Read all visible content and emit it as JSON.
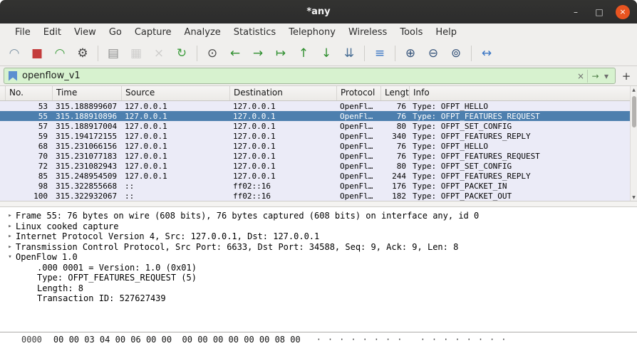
{
  "window": {
    "title": "*any",
    "controls": {
      "minimize": "–",
      "maximize": "□",
      "close": "×"
    }
  },
  "colors": {
    "titlebar_bg": "#2c2c2c",
    "close_button_bg": "#e95420",
    "filter_valid_bg": "#d7f2cf",
    "row_bg": "#ebebf7",
    "selected_row_bg": "#4d7fae",
    "selected_row_fg": "#ffffff"
  },
  "menu": {
    "items": [
      "File",
      "Edit",
      "View",
      "Go",
      "Capture",
      "Analyze",
      "Statistics",
      "Telephony",
      "Wireless",
      "Tools",
      "Help"
    ]
  },
  "toolbar": {
    "buttons": [
      {
        "name": "start-capture-icon",
        "glyph": "◠",
        "color": "#7d93a5"
      },
      {
        "name": "stop-capture-icon",
        "glyph": "■",
        "color": "#c43c3c"
      },
      {
        "name": "restart-capture-icon",
        "glyph": "◠",
        "color": "#3f9e3f"
      },
      {
        "name": "capture-options-icon",
        "glyph": "⚙",
        "color": "#474747"
      },
      {
        "sep": true
      },
      {
        "name": "open-file-icon",
        "glyph": "▤",
        "color": "#8c8c8c"
      },
      {
        "name": "save-file-icon",
        "glyph": "▦",
        "color": "#9a9a9a",
        "disabled": true
      },
      {
        "name": "close-file-icon",
        "glyph": "×",
        "color": "#9a9a9a",
        "disabled": true
      },
      {
        "name": "reload-file-icon",
        "glyph": "↻",
        "color": "#3f9e3f"
      },
      {
        "sep": true
      },
      {
        "name": "find-packet-icon",
        "glyph": "⊙",
        "color": "#474747"
      },
      {
        "name": "go-back-icon",
        "glyph": "←",
        "color": "#2f8f2f"
      },
      {
        "name": "go-forward-icon",
        "glyph": "→",
        "color": "#2f8f2f"
      },
      {
        "name": "go-to-packet-icon",
        "glyph": "↦",
        "color": "#2f8f2f"
      },
      {
        "name": "go-first-icon",
        "glyph": "↑",
        "color": "#2f8f2f"
      },
      {
        "name": "go-last-icon",
        "glyph": "↓",
        "color": "#2f8f2f"
      },
      {
        "name": "auto-scroll-icon",
        "glyph": "⇊",
        "color": "#4a6f95"
      },
      {
        "sep": true
      },
      {
        "name": "colorize-icon",
        "glyph": "≡",
        "color": "#3a76c4"
      },
      {
        "sep": true
      },
      {
        "name": "zoom-in-icon",
        "glyph": "⊕",
        "color": "#35537a"
      },
      {
        "name": "zoom-out-icon",
        "glyph": "⊖",
        "color": "#35537a"
      },
      {
        "name": "zoom-reset-icon",
        "glyph": "⊚",
        "color": "#35537a"
      },
      {
        "sep": true
      },
      {
        "name": "resize-columns-icon",
        "glyph": "↔",
        "color": "#3a76c4"
      }
    ]
  },
  "filter": {
    "value": "openflow_v1",
    "clear_glyph": "×",
    "apply_glyph": "→",
    "dropdown_glyph": "▾",
    "add_label": "+"
  },
  "packet_list": {
    "columns": [
      "No.",
      "Time",
      "Source",
      "Destination",
      "Protocol",
      "Length",
      "Info"
    ],
    "rows": [
      {
        "no": "53",
        "time": "315.188899607",
        "source": "127.0.0.1",
        "destination": "127.0.0.1",
        "protocol": "OpenFl…",
        "length": "76",
        "info": "Type: OFPT_HELLO",
        "selected": false
      },
      {
        "no": "55",
        "time": "315.188910896",
        "source": "127.0.0.1",
        "destination": "127.0.0.1",
        "protocol": "OpenFl…",
        "length": "76",
        "info": "Type: OFPT_FEATURES_REQUEST",
        "selected": true
      },
      {
        "no": "57",
        "time": "315.188917004",
        "source": "127.0.0.1",
        "destination": "127.0.0.1",
        "protocol": "OpenFl…",
        "length": "80",
        "info": "Type: OFPT_SET_CONFIG",
        "selected": false
      },
      {
        "no": "59",
        "time": "315.194172155",
        "source": "127.0.0.1",
        "destination": "127.0.0.1",
        "protocol": "OpenFl…",
        "length": "340",
        "info": "Type: OFPT_FEATURES_REPLY",
        "selected": false
      },
      {
        "no": "68",
        "time": "315.231066156",
        "source": "127.0.0.1",
        "destination": "127.0.0.1",
        "protocol": "OpenFl…",
        "length": "76",
        "info": "Type: OFPT_HELLO",
        "selected": false
      },
      {
        "no": "70",
        "time": "315.231077183",
        "source": "127.0.0.1",
        "destination": "127.0.0.1",
        "protocol": "OpenFl…",
        "length": "76",
        "info": "Type: OFPT_FEATURES_REQUEST",
        "selected": false
      },
      {
        "no": "72",
        "time": "315.231082943",
        "source": "127.0.0.1",
        "destination": "127.0.0.1",
        "protocol": "OpenFl…",
        "length": "80",
        "info": "Type: OFPT_SET_CONFIG",
        "selected": false
      },
      {
        "no": "85",
        "time": "315.248954509",
        "source": "127.0.0.1",
        "destination": "127.0.0.1",
        "protocol": "OpenFl…",
        "length": "244",
        "info": "Type: OFPT_FEATURES_REPLY",
        "selected": false
      },
      {
        "no": "98",
        "time": "315.322855668",
        "source": "::",
        "destination": "ff02::16",
        "protocol": "OpenFl…",
        "length": "176",
        "info": "Type: OFPT_PACKET_IN",
        "selected": false
      },
      {
        "no": "100",
        "time": "315.322932067",
        "source": "::",
        "destination": "ff02::16",
        "protocol": "OpenFl…",
        "length": "182",
        "info": "Type: OFPT_PACKET_OUT",
        "selected": false
      }
    ]
  },
  "scrollbar": {
    "up": "▲",
    "down": "▼"
  },
  "detail": {
    "collapsed_glyph": "▸",
    "expanded_glyph": "▾",
    "lines": [
      {
        "expanded": false,
        "child": false,
        "text": "Frame 55: 76 bytes on wire (608 bits), 76 bytes captured (608 bits) on interface any, id 0"
      },
      {
        "expanded": false,
        "child": false,
        "text": "Linux cooked capture"
      },
      {
        "expanded": false,
        "child": false,
        "text": "Internet Protocol Version 4, Src: 127.0.0.1, Dst: 127.0.0.1"
      },
      {
        "expanded": false,
        "child": false,
        "text": "Transmission Control Protocol, Src Port: 6633, Dst Port: 34588, Seq: 9, Ack: 9, Len: 8"
      },
      {
        "expanded": true,
        "child": false,
        "text": "OpenFlow 1.0"
      },
      {
        "child": true,
        "text": ".000 0001 = Version: 1.0 (0x01)"
      },
      {
        "child": true,
        "text": "Type: OFPT_FEATURES_REQUEST (5)"
      },
      {
        "child": true,
        "text": "Length: 8"
      },
      {
        "child": true,
        "text": "Transaction ID: 527627439"
      }
    ]
  },
  "hex": {
    "offset": "0000",
    "bytes": "00 00 03 04 00 06 00 00  00 00 00 00 00 00 08 00",
    "ascii": "········ ········"
  }
}
